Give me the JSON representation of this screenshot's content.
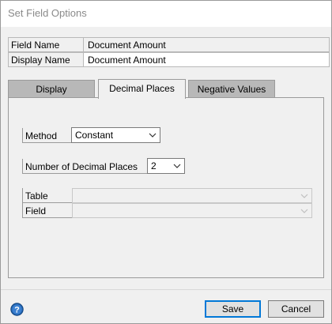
{
  "window": {
    "title": "Set Field Options"
  },
  "fields": {
    "field_name_label": "Field Name",
    "field_name_value": "Document Amount",
    "display_name_label": "Display Name",
    "display_name_value": "Document Amount"
  },
  "tabs": [
    {
      "label": "Display",
      "active": false
    },
    {
      "label": "Decimal Places",
      "active": true
    },
    {
      "label": "Negative Values",
      "active": false
    }
  ],
  "decimal_places": {
    "method_label": "Method",
    "method_value": "Constant",
    "num_places_label": "Number of Decimal Places",
    "num_places_value": "2",
    "table_label": "Table",
    "table_value": "",
    "field_label": "Field",
    "field_value": ""
  },
  "footer": {
    "help_icon": "help-circle-icon",
    "save_label": "Save",
    "cancel_label": "Cancel"
  },
  "colors": {
    "accent": "#0078d7",
    "help_icon": "#1f5fa8",
    "inactive_tab": "#b8b8b8"
  }
}
